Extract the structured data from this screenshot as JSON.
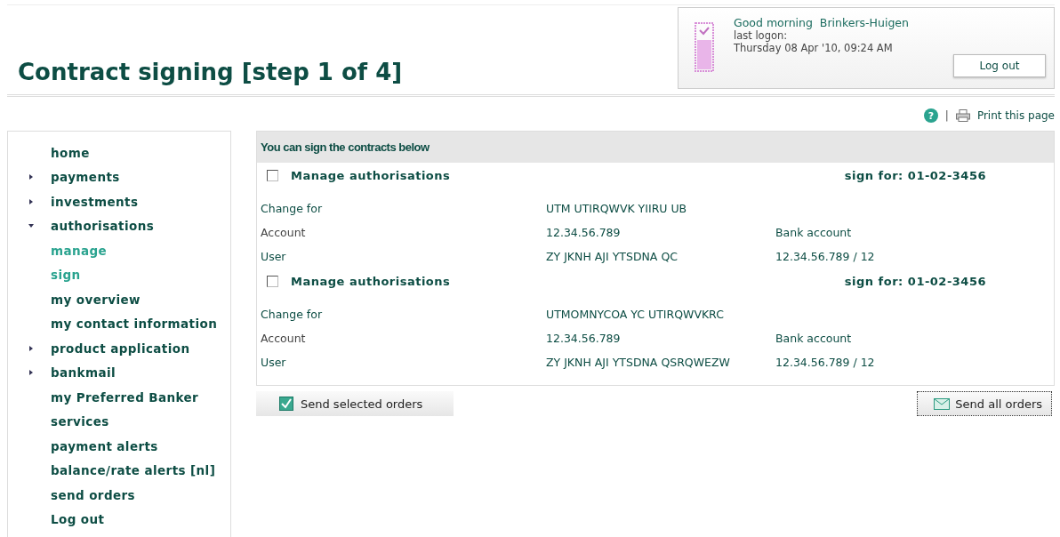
{
  "page_title": "Contract signing [step 1 of 4]",
  "greeting": {
    "salutation": "Good morning",
    "name": "Brinkers-Huigen",
    "last_logon_label": "last logon:",
    "last_logon": "Thursday 08 Apr '10, 09:24 AM",
    "logout_button": "Log out"
  },
  "tools": {
    "help": "?",
    "separator": "|",
    "print": "Print this page"
  },
  "sidebar": {
    "items": [
      {
        "label": "home",
        "kind": "link",
        "active": false
      },
      {
        "label": "payments",
        "kind": "group",
        "expanded": false,
        "active": false
      },
      {
        "label": "investments",
        "kind": "group",
        "expanded": false,
        "active": false
      },
      {
        "label": "authorisations",
        "kind": "group",
        "expanded": true,
        "active": false
      },
      {
        "label": "manage",
        "kind": "link",
        "active": true
      },
      {
        "label": "sign",
        "kind": "link",
        "active": true
      },
      {
        "label": "my overview",
        "kind": "link",
        "active": false
      },
      {
        "label": "my contact information",
        "kind": "link",
        "active": false
      },
      {
        "label": "product application",
        "kind": "group",
        "expanded": false,
        "active": false
      },
      {
        "label": "bankmail",
        "kind": "group",
        "expanded": false,
        "active": false
      },
      {
        "label": "my Preferred Banker",
        "kind": "link",
        "active": false
      },
      {
        "label": "services",
        "kind": "link",
        "active": false
      },
      {
        "label": "payment alerts",
        "kind": "link",
        "active": false
      },
      {
        "label": "balance/rate alerts [nl]",
        "kind": "link",
        "active": false
      },
      {
        "label": "send orders",
        "kind": "link",
        "active": false
      },
      {
        "label": "Log out",
        "kind": "link",
        "active": false
      }
    ]
  },
  "panel": {
    "heading": "You can sign the contracts below",
    "contracts": [
      {
        "title": "Manage authorisations",
        "checked": false,
        "sign_for": "sign for: 01-02-3456",
        "rows": [
          {
            "label": "Change for",
            "value": "UTM UTIRQWVK YIIRU UB"
          },
          {
            "label": "Account",
            "value": "12.34.56.789",
            "extra": "Bank account"
          },
          {
            "label": "User",
            "value": "ZY JKNH AJI YTSDNA QC",
            "extra": "12.34.56.789 / 12"
          }
        ]
      },
      {
        "title": "Manage authorisations",
        "checked": false,
        "sign_for": "sign for: 01-02-3456",
        "rows": [
          {
            "label": "Change for",
            "value": "UTMOMNYCOA YC UTIRQWVKRC"
          },
          {
            "label": "Account",
            "value": "12.34.56.789",
            "extra": "Bank account"
          },
          {
            "label": "User",
            "value": "ZY JKNH AJI YTSDNA QSRQWEZW",
            "extra": "12.34.56.789 / 12"
          }
        ]
      }
    ]
  },
  "buttons": {
    "send_selected": "Send selected orders",
    "send_all": "Send all orders"
  }
}
